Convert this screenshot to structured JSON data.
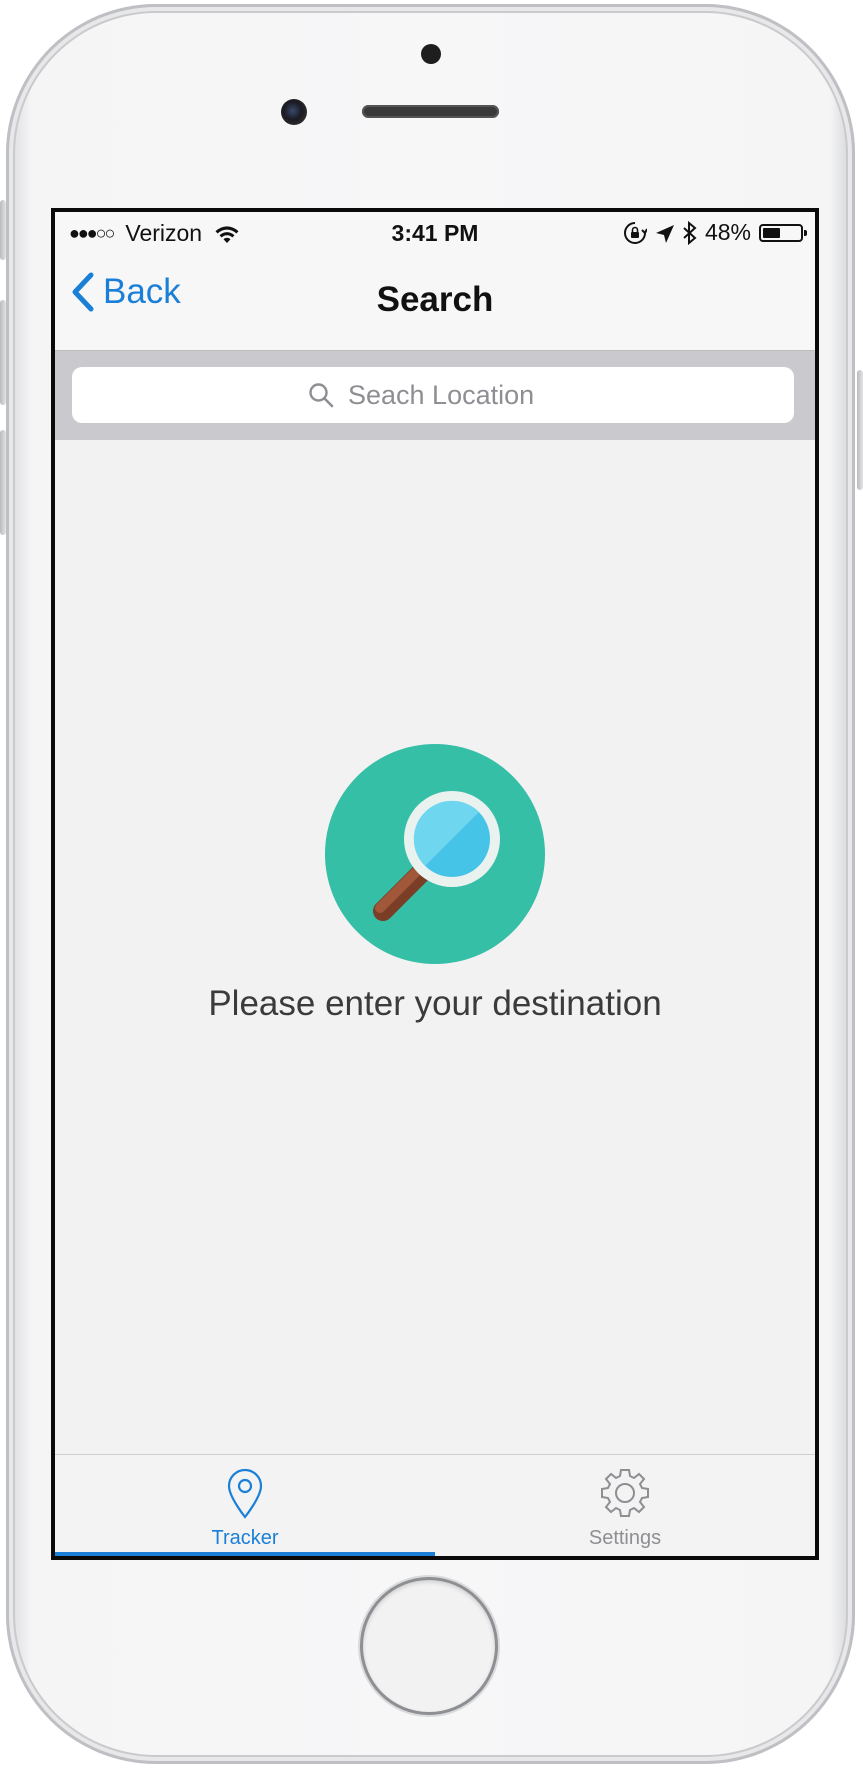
{
  "status_bar": {
    "signal_dots": "●●●○○",
    "carrier": "Verizon",
    "time": "3:41 PM",
    "battery_percent": "48%",
    "battery_level": 0.48,
    "icons": [
      "wifi-icon",
      "rotation-lock-icon",
      "location-arrow-icon",
      "bluetooth-icon",
      "battery-icon"
    ]
  },
  "nav": {
    "back_label": "Back",
    "title": "Search"
  },
  "search": {
    "placeholder": "Seach Location",
    "value": ""
  },
  "empty_state": {
    "message": "Please enter your destination",
    "icon": "magnifying-glass-icon"
  },
  "tabs": [
    {
      "label": "Tracker",
      "icon": "map-pin-icon",
      "active": true
    },
    {
      "label": "Settings",
      "icon": "gear-icon",
      "active": false
    }
  ],
  "colors": {
    "accent": "#1a7fd6",
    "empty_icon_circle": "#35bfa6",
    "lens": "#45c4e8",
    "handle": "#8b4a2f",
    "inactive_tab": "#8e8e93"
  }
}
